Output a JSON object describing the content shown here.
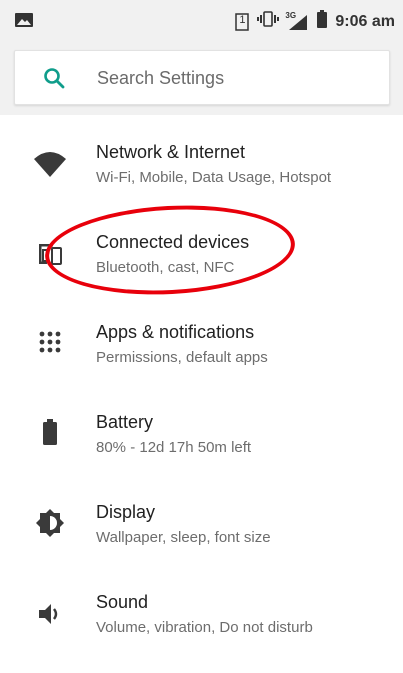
{
  "status_bar": {
    "sim_slot": "1",
    "network_type": "3G",
    "time": "9:06 am",
    "icons": [
      "image-icon",
      "sim-1-icon",
      "vibrate-icon",
      "signal-icon",
      "battery-icon"
    ]
  },
  "search": {
    "placeholder": "Search Settings",
    "icon": "search-icon",
    "accent_color": "#0f9d8b"
  },
  "settings": [
    {
      "title": "Network & Internet",
      "subtitle": "Wi-Fi, Mobile, Data Usage, Hotspot",
      "icon": "wifi-icon"
    },
    {
      "title": "Connected devices",
      "subtitle": "Bluetooth, cast, NFC",
      "icon": "devices-icon"
    },
    {
      "title": "Apps & notifications",
      "subtitle": "Permissions, default apps",
      "icon": "apps-grid-icon"
    },
    {
      "title": "Battery",
      "subtitle": "80% - 12d 17h 50m left",
      "icon": "battery-icon"
    },
    {
      "title": "Display",
      "subtitle": "Wallpaper, sleep, font size",
      "icon": "brightness-icon"
    },
    {
      "title": "Sound",
      "subtitle": "Volume, vibration, Do not disturb",
      "icon": "volume-icon"
    }
  ],
  "annotation": {
    "shape": "ellipse",
    "color": "#e8000b",
    "highlights": "Connected devices"
  }
}
